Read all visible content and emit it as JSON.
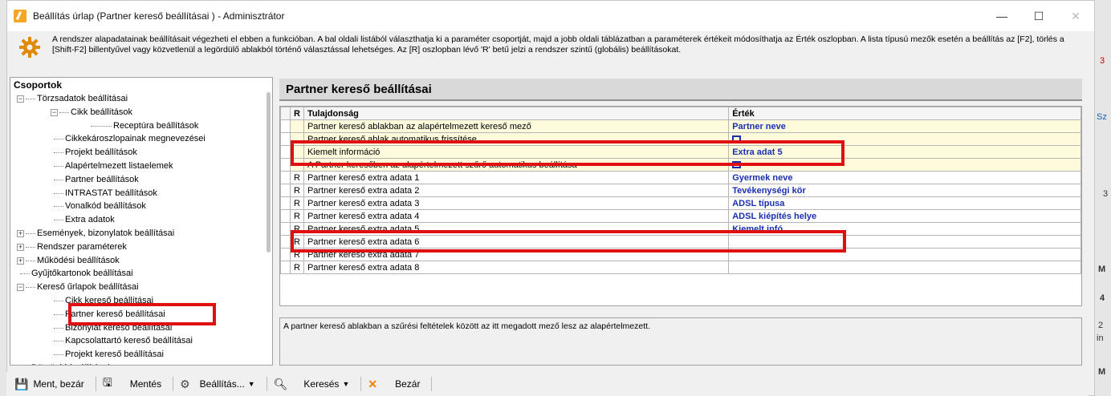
{
  "window": {
    "title": "Beállítás úrlap (Partner kereső beállításai ) - Adminisztrátor",
    "minimize": "—",
    "maximize": "☐",
    "close": "✕"
  },
  "info_text": "A rendszer alapadatainak beállításait végezheti el ebben a funkcióban. A bal oldali listából választhatja ki a paraméter csoportját, majd a jobb oldali táblázatban a paraméterek értékeit módosíthatja az Érték oszlopban. A lista típusú mezők esetén a beállítás az [F2], törlés a [Shift-F2] billentyűvel vagy közvetlenül a legördülő ablakból történő választással lehetséges. Az [R] oszlopban lévő 'R' betű jelzi a rendszer szintű (globális) beállításokat.",
  "tree": {
    "title": "Csoportok",
    "items": [
      {
        "label": "Törzsadatok beállításai",
        "level": 0,
        "expander": "−"
      },
      {
        "label": "Cikk beállítások",
        "level": 1,
        "expander": "−"
      },
      {
        "label": "Receptúra beállítások",
        "level": 2,
        "expander": ""
      },
      {
        "label": "Cikkekároszlopainak megnevezései",
        "level": 1,
        "expander": ""
      },
      {
        "label": "Projekt beállítások",
        "level": 1,
        "expander": ""
      },
      {
        "label": "Alapértelmezett listaelemek",
        "level": 1,
        "expander": ""
      },
      {
        "label": "Partner beállítások",
        "level": 1,
        "expander": ""
      },
      {
        "label": "INTRASTAT beállítások",
        "level": 1,
        "expander": ""
      },
      {
        "label": "Vonalkód beállítások",
        "level": 1,
        "expander": ""
      },
      {
        "label": "Extra adatok",
        "level": 1,
        "expander": ""
      },
      {
        "label": "Események, bizonylatok beállításai",
        "level": 0,
        "expander": "+"
      },
      {
        "label": "Rendszer paraméterek",
        "level": 0,
        "expander": "+"
      },
      {
        "label": "Működési beállítások",
        "level": 0,
        "expander": "+"
      },
      {
        "label": "Gyűjtőkartonok beállításai",
        "level": 0,
        "expander": ""
      },
      {
        "label": "Kereső űrlapok beállításai",
        "level": 0,
        "expander": "−"
      },
      {
        "label": "Cikk kereső beállításai",
        "level": 1,
        "expander": ""
      },
      {
        "label": "Partner kereső beállításai",
        "level": 1,
        "expander": ""
      },
      {
        "label": "Bizonylat kereső beállításai",
        "level": 1,
        "expander": ""
      },
      {
        "label": "Kapcsolattartó kereső beállításai",
        "level": 1,
        "expander": ""
      },
      {
        "label": "Projekt kereső beállításai",
        "level": 1,
        "expander": ""
      },
      {
        "label": "Dömöréé beállítások",
        "level": 0,
        "expander": ""
      }
    ]
  },
  "section_title": "Partner kereső beállításai",
  "grid": {
    "headers": {
      "r": "R",
      "property": "Tulajdonság",
      "value": "Érték"
    },
    "rows": [
      {
        "r": "",
        "property": "Partner kereső ablakban az alapértelmezett kereső mező",
        "value": "Partner neve",
        "checkbox": false,
        "yellow": true
      },
      {
        "r": "",
        "property": "Partner kereső ablak automatikus frissítése",
        "value": "",
        "checkbox": true,
        "yellow": true
      },
      {
        "r": "",
        "property": "Kiemelt információ",
        "value": "Extra adat 5",
        "checkbox": false,
        "yellow": true
      },
      {
        "r": "",
        "property": "A Partner keresőben az alapértelmezett szűrő automatikus beállítása",
        "value": "",
        "checkbox": true,
        "yellow": true
      },
      {
        "r": "R",
        "property": "Partner kereső extra adata 1",
        "value": "Gyermek neve",
        "checkbox": false,
        "yellow": false
      },
      {
        "r": "R",
        "property": "Partner kereső extra adata 2",
        "value": "Tevékenységi kör",
        "checkbox": false,
        "yellow": false
      },
      {
        "r": "R",
        "property": "Partner kereső extra adata 3",
        "value": "ADSL típusa",
        "checkbox": false,
        "yellow": false
      },
      {
        "r": "R",
        "property": "Partner kereső extra adata 4",
        "value": "ADSL kiépítés helye",
        "checkbox": false,
        "yellow": false
      },
      {
        "r": "R",
        "property": "Partner kereső extra adata 5",
        "value": "Kiemelt infó",
        "checkbox": false,
        "yellow": false
      },
      {
        "r": "R",
        "property": "Partner kereső extra adata 6",
        "value": "",
        "checkbox": false,
        "yellow": false
      },
      {
        "r": "R",
        "property": "Partner kereső extra adata 7",
        "value": "",
        "checkbox": false,
        "yellow": false
      },
      {
        "r": "R",
        "property": "Partner kereső extra adata 8",
        "value": "",
        "checkbox": false,
        "yellow": false
      }
    ]
  },
  "description": "A partner kereső ablakban a szűrési feltételek között az itt megadott mező lesz az alapértelmezett.",
  "toolbar": {
    "save_close": "Ment, bezár",
    "save": "Mentés",
    "settings": "Beállítás...",
    "search": "Keresés",
    "close": "Bezár"
  },
  "edge_fragments": [
    "3",
    "Sz",
    "3",
    "M",
    "4",
    "2",
    "in",
    "M"
  ],
  "colors": {
    "highlight": "#e01010",
    "value_text": "#1a2fb0",
    "row_yellow": "#fdfbdc"
  }
}
